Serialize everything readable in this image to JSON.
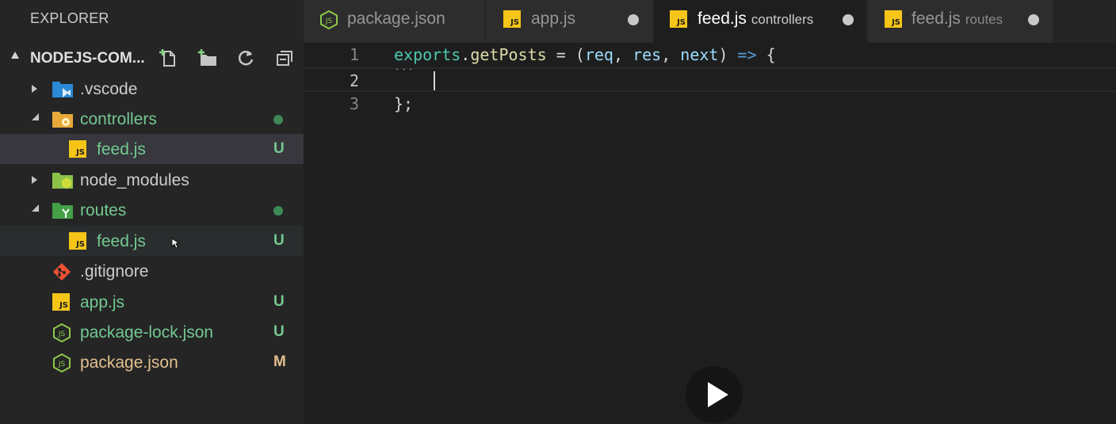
{
  "sidebar": {
    "title": "EXPLORER",
    "project": "NODEJS-COM...",
    "tree": [
      {
        "label": ".vscode",
        "icon": "vscode-folder-icon",
        "badge": ""
      },
      {
        "label": "controllers",
        "icon": "controllers-folder-icon",
        "badge": ""
      },
      {
        "label": "feed.js",
        "icon": "js-file-icon",
        "badge": "U"
      },
      {
        "label": "node_modules",
        "icon": "node-folder-icon",
        "badge": ""
      },
      {
        "label": "routes",
        "icon": "routes-folder-icon",
        "badge": ""
      },
      {
        "label": "feed.js",
        "icon": "js-file-icon",
        "badge": "U"
      },
      {
        "label": ".gitignore",
        "icon": "git-icon",
        "badge": ""
      },
      {
        "label": "app.js",
        "icon": "js-file-icon",
        "badge": "U"
      },
      {
        "label": "package-lock.json",
        "icon": "nodejs-icon",
        "badge": "U"
      },
      {
        "label": "package.json",
        "icon": "nodejs-icon",
        "badge": "M"
      }
    ]
  },
  "tabs": [
    {
      "label": "package.json",
      "desc": ""
    },
    {
      "label": "app.js",
      "desc": ""
    },
    {
      "label": "feed.js",
      "desc": "controllers"
    },
    {
      "label": "feed.js",
      "desc": "routes"
    }
  ],
  "editor": {
    "line_numbers": [
      "1",
      "2",
      "3"
    ],
    "line1": {
      "t1": "exports",
      "t2": ".",
      "t3": "getPosts",
      "t4": " = (",
      "t5": "req",
      "t6": ", ",
      "t7": "res",
      "t8": ", ",
      "t9": "next",
      "t10": ") ",
      "t11": "=>",
      "t12": " {"
    },
    "line3": "};",
    "hint": "..."
  },
  "colors": {
    "modified": "#e2c08d",
    "untracked": "#73c991",
    "js": "#f5c518"
  }
}
